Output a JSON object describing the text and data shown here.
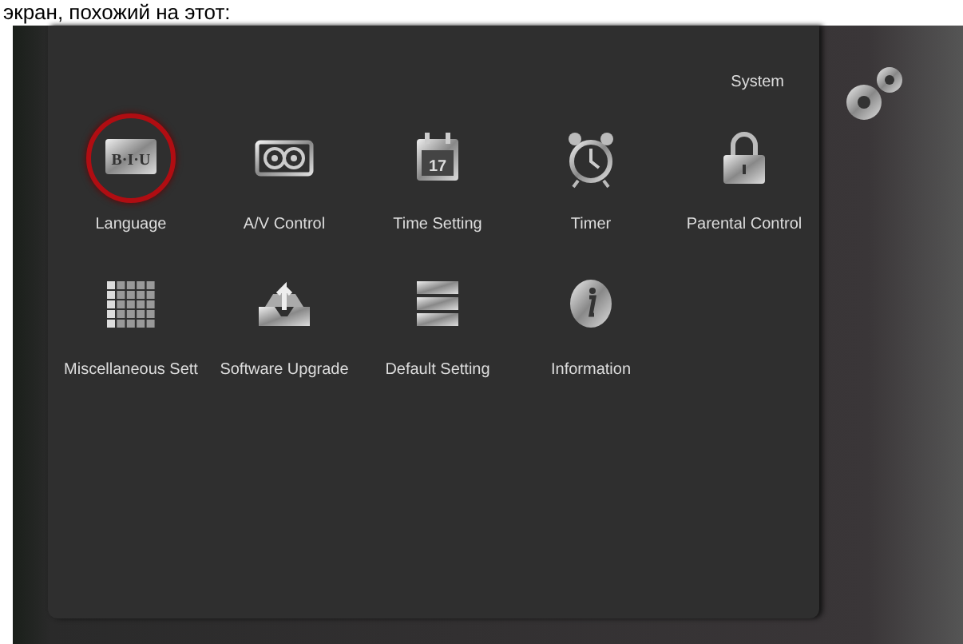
{
  "caption": "экран, похожий на этот:",
  "menu": {
    "title": "System"
  },
  "items": [
    {
      "label": "Language",
      "kind": "language",
      "icon_text": "B·I·U",
      "selected": true
    },
    {
      "label": "A/V Control",
      "kind": "av",
      "selected": false
    },
    {
      "label": "Time Setting",
      "kind": "calendar",
      "icon_text": "17",
      "selected": false
    },
    {
      "label": "Timer",
      "kind": "clock",
      "selected": false
    },
    {
      "label": "Parental Control",
      "kind": "lock",
      "selected": false
    },
    {
      "label": "Miscellaneous Sett",
      "kind": "grid",
      "selected": false
    },
    {
      "label": "Software Upgrade",
      "kind": "upgrade",
      "selected": false
    },
    {
      "label": "Default Setting",
      "kind": "stack",
      "selected": false
    },
    {
      "label": "Information",
      "kind": "info",
      "selected": false
    }
  ]
}
